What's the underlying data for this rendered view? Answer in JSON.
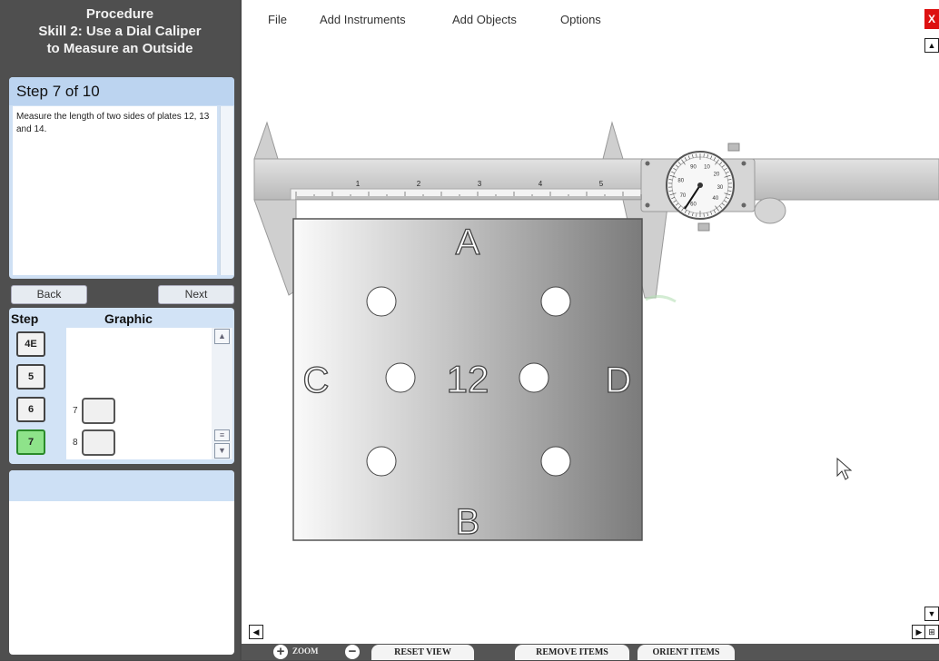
{
  "procedure": {
    "title_line1": "Procedure",
    "title_line2": "Skill 2: Use a Dial Caliper",
    "title_line3": "to Measure an Outside"
  },
  "step": {
    "header": "Step 7 of 10",
    "instruction": "Measure the length of two sides of plates 12, 13 and 14."
  },
  "nav": {
    "back": "Back",
    "next": "Next"
  },
  "graphic_panel": {
    "step_col": "Step",
    "graphic_col": "Graphic",
    "steps": [
      "4E",
      "5",
      "6",
      "7"
    ],
    "thumb_numbers": [
      "7",
      "8"
    ]
  },
  "menu": {
    "file": "File",
    "add_instruments": "Add Instruments",
    "add_objects": "Add Objects",
    "options": "Options"
  },
  "window": {
    "close": "X"
  },
  "caliper": {
    "scale_numbers": [
      "1",
      "2",
      "3",
      "4",
      "5"
    ],
    "dial_numbers": [
      "90",
      "10",
      "20",
      "30",
      "40",
      "60",
      "70",
      "80"
    ]
  },
  "plate": {
    "number": "12",
    "side_top": "A",
    "side_bottom": "B",
    "side_left": "C",
    "side_right": "D"
  },
  "toolbar": {
    "zoom_label": "ZOOM",
    "zoom_in": "+",
    "zoom_out": "−",
    "reset_view": "RESET VIEW",
    "remove_items": "REMOVE ITEMS",
    "orient_items": "ORIENT ITEMS"
  },
  "colors": {
    "active_step": "#8ee38a",
    "panel_blue": "#cfe0f4",
    "close_red": "#dd1111"
  }
}
